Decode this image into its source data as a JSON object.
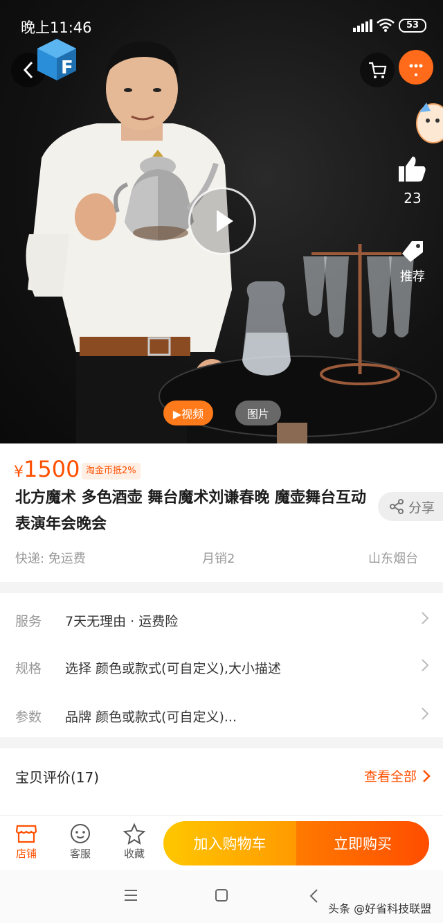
{
  "status_bar": {
    "time": "晚上11:46",
    "battery": "53"
  },
  "media": {
    "like_count": "23",
    "recommend_label": "推荐",
    "tabs": {
      "video": "▶视频",
      "photo": "图片"
    }
  },
  "product": {
    "currency": "¥",
    "price": "1500",
    "coin_badge": "淘金币抵2%",
    "title": "北方魔术  多色酒壶  舞台魔术刘谦春晚  魔壶舞台互动表演年会晚会",
    "share_label": "分享",
    "shipping": "快递: 免运费",
    "monthly_sales": "月销2",
    "location": "山东烟台"
  },
  "rows": [
    {
      "label": "服务",
      "value": "7天无理由 · 运费险"
    },
    {
      "label": "规格",
      "value": "选择 颜色或款式(可自定义),大小描述"
    },
    {
      "label": "参数",
      "value": "品牌 颜色或款式(可自定义)..."
    }
  ],
  "review": {
    "title": "宝贝评价(17)",
    "view_all": "查看全部"
  },
  "action_bar": {
    "shop": "店铺",
    "service": "客服",
    "favorite": "收藏",
    "add_to_cart": "加入购物车",
    "buy_now": "立即购买"
  },
  "watermark": "头条 @好省科技联盟",
  "colors": {
    "accent": "#ff5000",
    "cart_btn": "#ffb300",
    "buy_btn": "#ff5a00"
  }
}
